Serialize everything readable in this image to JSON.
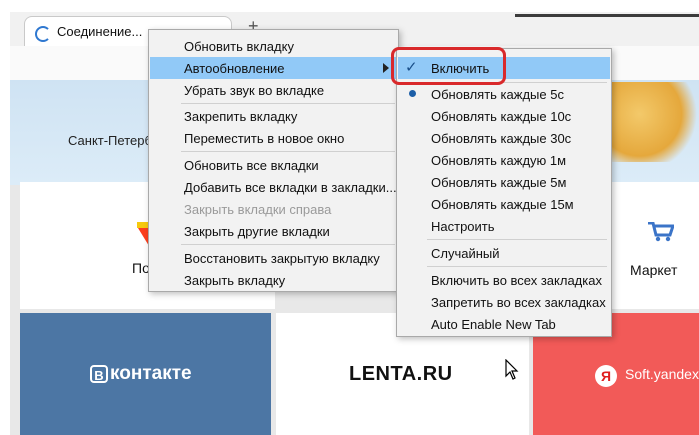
{
  "tab": {
    "title": "Соединение..."
  },
  "page": {
    "city": "Санкт-Петербу",
    "tiles": {
      "mail_label": "Почт",
      "market_label": "Маркет",
      "vk_logo": "контакте",
      "vk_box": "В",
      "lenta_logo": "LENTA.RU",
      "soft_label": "Soft.yandex",
      "soft_mark": "Я"
    }
  },
  "context_menu": {
    "items": [
      {
        "label": "Обновить вкладку"
      },
      {
        "label": "Автообновление"
      },
      {
        "label": "Убрать звук во вкладке"
      },
      {
        "label": "Закрепить вкладку"
      },
      {
        "label": "Переместить в новое окно"
      },
      {
        "label": "Обновить все вкладки"
      },
      {
        "label": "Добавить все вкладки в закладки..."
      },
      {
        "label": "Закрыть вкладки справа"
      },
      {
        "label": "Закрыть другие вкладки"
      },
      {
        "label": "Восстановить закрытую вкладку"
      },
      {
        "label": "Закрыть вкладку"
      }
    ]
  },
  "auto_refresh_submenu": {
    "items": [
      {
        "label": "Включить"
      },
      {
        "label": "Обновлять каждые 5с"
      },
      {
        "label": "Обновлять каждые 10с"
      },
      {
        "label": "Обновлять каждые 30с"
      },
      {
        "label": "Обновлять каждую 1м"
      },
      {
        "label": "Обновлять каждые 5м"
      },
      {
        "label": "Обновлять каждые 15м"
      },
      {
        "label": "Настроить"
      },
      {
        "label": "Случайный"
      },
      {
        "label": "Включить во всех закладках"
      },
      {
        "label": "Запретить во всех закладках"
      },
      {
        "label": "Auto Enable New Tab"
      }
    ]
  },
  "colors": {
    "highlight": "#91c9f7",
    "callout": "#d9292b",
    "vk": "#4c76a4",
    "soft": "#f25a58"
  }
}
